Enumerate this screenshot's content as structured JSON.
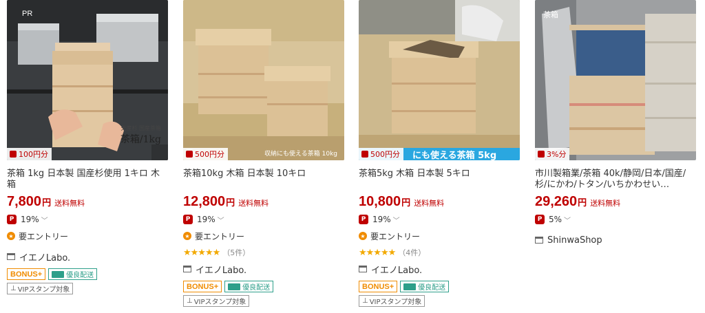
{
  "products": [
    {
      "pr_label": "PR",
      "overlay_top": "天産杉 国産茶箱",
      "overlay_main": "茶箱/1kg",
      "point_badge": "100円分",
      "title": "茶箱 1kg 日本製 国産杉使用 1キロ 木箱",
      "price": "7,800",
      "yen": "円",
      "shipping": "送料無料",
      "point_rate": "19%",
      "entry": "要エントリー",
      "shop": "イエノLabo.",
      "bonus": "BONUS+",
      "delivery": "優良配送",
      "vip": "VIPスタンプ対象"
    },
    {
      "overlay_caption": "収納にも使える茶箱 10kg",
      "point_badge": "500円分",
      "title": "茶箱10kg 木箱 日本製 10キロ",
      "price": "12,800",
      "yen": "円",
      "shipping": "送料無料",
      "point_rate": "19%",
      "entry": "要エントリー",
      "stars": "★★★★★",
      "review_count": "（5件）",
      "shop": "イエノLabo.",
      "bonus": "BONUS+",
      "delivery": "優良配送",
      "vip": "VIPスタンプ対象"
    },
    {
      "caption_strip": "にも使える茶箱 5kg",
      "point_badge": "500円分",
      "title": "茶箱5kg 木箱 日本製 5キロ",
      "price": "10,800",
      "yen": "円",
      "shipping": "送料無料",
      "point_rate": "19%",
      "entry": "要エントリー",
      "stars": "★★★★★",
      "review_count": "（4件）",
      "shop": "イエノLabo.",
      "bonus": "BONUS+",
      "delivery": "優良配送",
      "vip": "VIPスタンプ対象"
    },
    {
      "overlay_main": "茶箱",
      "point_badge": "3%分",
      "title": "市川製箱業/茶箱 40k/静岡/日本/国産/杉/にかわ/トタン/いちかわせい…",
      "price": "29,260",
      "yen": "円",
      "shipping": "送料無料",
      "point_rate": "5%",
      "shop": "ShinwaShop"
    }
  ],
  "colors": {
    "price_red": "#bf0000",
    "bonus_orange": "#f08c00",
    "delivery_teal": "#2d9f8a",
    "star_gold": "#f2a900",
    "caption_blue": "#2aa7e0"
  },
  "icons": {
    "point": "rakuten-point-icon",
    "entry": "entry-star-icon",
    "shop": "shop-icon",
    "truck": "truck-icon",
    "chevron": "chevron-down-icon"
  }
}
